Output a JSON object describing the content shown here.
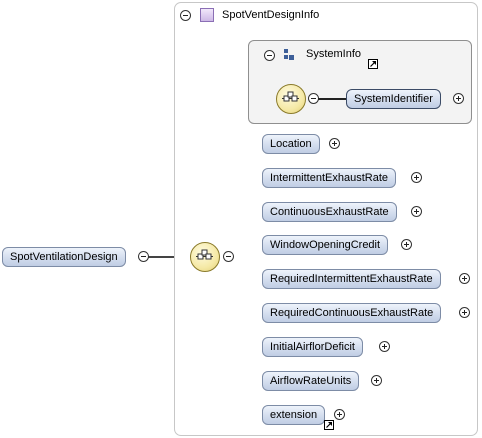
{
  "root_element": {
    "label": "SpotVentilationDesign"
  },
  "complex_type": {
    "title": "SpotVentDesignInfo"
  },
  "group": {
    "title": "SystemInfo",
    "children": [
      {
        "label": "SystemIdentifier"
      }
    ]
  },
  "elements": [
    {
      "label": "Location"
    },
    {
      "label": "IntermittentExhaustRate"
    },
    {
      "label": "ContinuousExhaustRate"
    },
    {
      "label": "WindowOpeningCredit"
    },
    {
      "label": "RequiredIntermittentExhaustRate"
    },
    {
      "label": "RequiredContinuousExhaustRate"
    },
    {
      "label": "InitialAirflorDeficit"
    },
    {
      "label": "AirflowRateUnits"
    },
    {
      "label": "extension"
    }
  ]
}
